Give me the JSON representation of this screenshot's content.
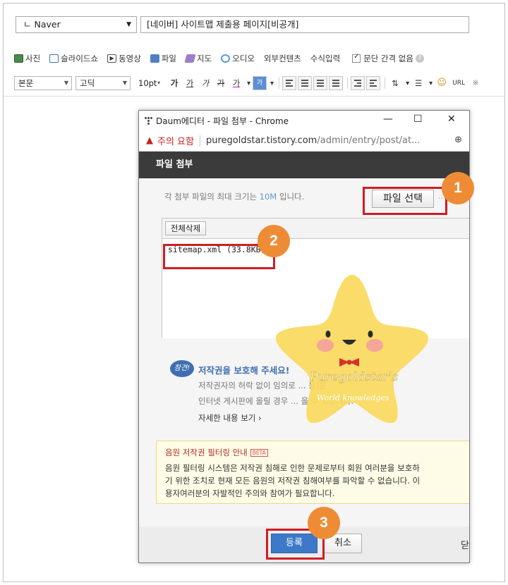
{
  "post": {
    "category": "ㄴ Naver",
    "title": "[네이버] 사이트맵 제출용 페이지[비공개]"
  },
  "attach_toolbar": {
    "items": [
      "사진",
      "슬라이드쇼",
      "동영상",
      "파일",
      "지도",
      "오디오",
      "외부컨텐츠",
      "수식입력"
    ],
    "paragraph_spacing_label": "문단 간격 없음"
  },
  "format_toolbar": {
    "paragraph_style": "본문",
    "font": "고딕",
    "font_size": "10pt",
    "bold": "가",
    "underline": "가",
    "italic": "가",
    "strike": "가",
    "font_color": "가",
    "url_label": "URL"
  },
  "popup": {
    "window_title": "Daum에디터 - 파일 첨부 - Chrome",
    "warning_text": "주의 요함",
    "url_host": "puregoldstar.tistory.com",
    "url_path": "/admin/entry/post/at...",
    "panel_title": "파일 첨부",
    "limit_text_prefix": "각 첨부 파일의 최대 크기는 ",
    "limit_size": "10M",
    "limit_text_suffix": " 입니다.",
    "file_select_button": "파일 선택",
    "delete_all_button": "전체삭제",
    "files": [
      "sitemap.xml (33.8KB)"
    ],
    "copyright_badge": "참견!",
    "copyright_title": "저작권을 보호해 주세요!",
    "copyright_lines": [
      "저작권자의 허락 없이 임의로 ... 등)을",
      "인터넷 게시판에 올릴 경우 ... 을 수 있습니다."
    ],
    "copyright_more": "자세한 내용 보기 ›",
    "music_title": "음원 저작권 필터링 안내",
    "beta_label": "BETA",
    "music_lines": [
      "음원 필터링 시스템은 저작권 침해로 인한 문제로부터 회원 여러분을 보호하",
      "기 위한 조치로 현재 모든 음원의 저작권 침해여부를 파악할 수 없습니다. 이",
      "용자여러분의 자발적인 주의와 참여가 필요합니다."
    ],
    "register_button": "등록",
    "cancel_button": "취소",
    "close_cut": "닫"
  },
  "annotations": {
    "steps": [
      "1",
      "2",
      "3"
    ]
  },
  "watermark": {
    "line1": "Puregoldstar's",
    "line2": "World knowledges"
  },
  "colors": {
    "accent_blue": "#3d79c8",
    "annotation_red": "#d01d24",
    "step_orange": "#ee8c36",
    "header_dark": "#3b3b3b"
  }
}
